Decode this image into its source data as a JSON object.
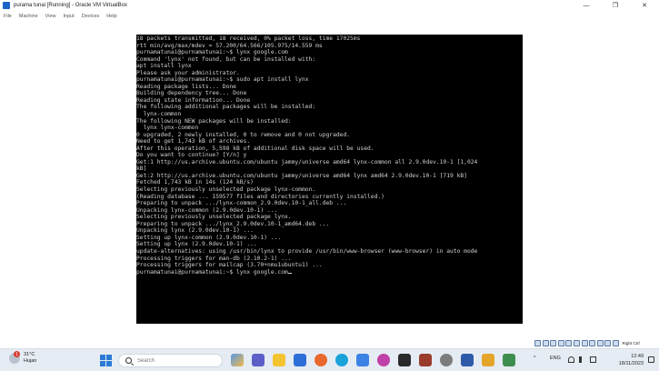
{
  "window": {
    "title": "purama tunai [Running] - Oracle VM VirtualBox",
    "minimize_glyph": "—",
    "restore_glyph": "❐",
    "close_glyph": "✕"
  },
  "menu": [
    "File",
    "Machine",
    "View",
    "Input",
    "Devices",
    "Help"
  ],
  "terminal": {
    "lines": [
      "18 packets transmitted, 18 received, 0% packet loss, time 17025ms",
      "rtt min/avg/max/mdev = 57.200/64.566/105.975/14.559 ms",
      "purnamatunai@purnamatunai:~$ lynx google.com",
      "Command 'lynx' not found, but can be installed with:",
      "apt install lynx",
      "Please ask your administrator.",
      "purnamatunai@purnamatunai:~$ sudo apt install lynx",
      "Reading package lists... Done",
      "Building dependency tree... Done",
      "Reading state information... Done",
      "The following additional packages will be installed:",
      "  lynx-common",
      "The following NEW packages will be installed:",
      "  lynx lynx-common",
      "0 upgraded, 2 newly installed, 0 to remove and 0 not upgraded.",
      "Need to get 1,743 kB of archives.",
      "After this operation, 5,598 kB of additional disk space will be used.",
      "Do you want to continue? [Y/n] y",
      "Get:1 http://us.archive.ubuntu.com/ubuntu jammy/universe amd64 lynx-common all 2.9.0dev.10-1 [1,024",
      "kB]",
      "Get:2 http://us.archive.ubuntu.com/ubuntu jammy/universe amd64 lynx amd64 2.9.0dev.10-1 [719 kB]",
      "Fetched 1,743 kB in 14s (124 kB/s)",
      "Selecting previously unselected package lynx-common.",
      "(Reading database ... 159577 files and directories currently installed.)",
      "Preparing to unpack .../lynx-common_2.9.0dev.10-1_all.deb ...",
      "Unpacking lynx-common (2.9.0dev.10-1) ...",
      "Selecting previously unselected package lynx.",
      "Preparing to unpack .../lynx_2.9.0dev.10-1_amd64.deb ...",
      "Unpacking lynx (2.9.0dev.10-1) ...",
      "Setting up lynx-common (2.9.0dev.10-1) ...",
      "Setting up lynx (2.9.0dev.10-1) ...",
      "update-alternatives: using /usr/bin/lynx to provide /usr/bin/www-browser (www-browser) in auto mode",
      "Processing triggers for man-db (2.10.2-1) ...",
      "Processing triggers for mailcap (3.70+nmu1ubuntu1) ...",
      "purnamatunai@purnamatunai:~$ lynx google.com"
    ]
  },
  "vbox_status": {
    "host_key": "Right Ctrl"
  },
  "taskbar": {
    "weather": {
      "badge": "1",
      "temp": "31°C",
      "condition": "Hujan"
    },
    "search_placeholder": "Search",
    "tray": {
      "language": "ENG",
      "time": "12:49",
      "date": "18/11/2023",
      "chevron": "^"
    }
  },
  "colors": {
    "terminal_bg": "#000000",
    "terminal_fg": "#d0d0d0",
    "taskbar_bg": "#e6ecf3"
  }
}
